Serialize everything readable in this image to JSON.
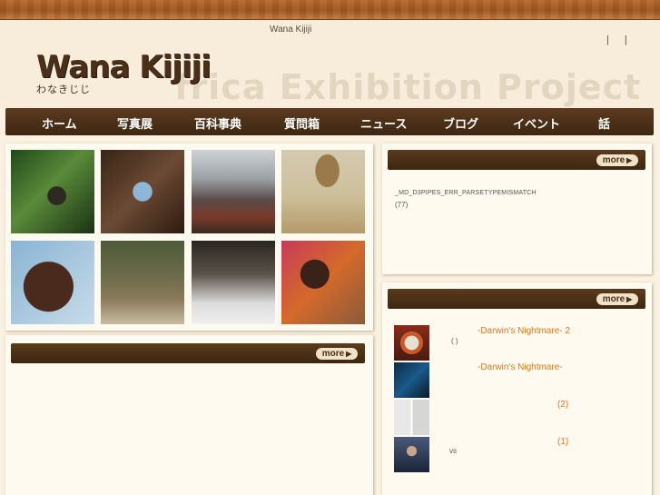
{
  "site": {
    "title": "Wana Kijiji",
    "top_links": [
      "|",
      "|"
    ],
    "watermark": "frica Exhibition Project",
    "logo_main": "Wana Kijiji",
    "logo_sub": "わなきじじ"
  },
  "nav": {
    "items": [
      "ホーム",
      "写真展",
      "百科事典",
      "質問箱",
      "ニュース",
      "ブログ",
      "イベント",
      "話"
    ]
  },
  "photos": {
    "items": [
      "jungle-insect",
      "blue-beetle",
      "crowd",
      "donkey-cart",
      "smiling-man",
      "ceremony",
      "rock-snow",
      "children-cooking"
    ]
  },
  "panels": {
    "more_label": "more",
    "right_top": {
      "error_text": "_MD_D3PIPES_ERR_PARSETYPEMISMATCH",
      "count": "(77)"
    },
    "right_bottom": {
      "entries": [
        {
          "title": "-Darwin's Nightmare-  2",
          "sub": "(  )"
        },
        {
          "title": "-Darwin's Nightmare-",
          "sub": ""
        },
        {
          "title": "(2)",
          "sub": ""
        },
        {
          "title": "(1)",
          "sub": "vs"
        }
      ]
    }
  },
  "colors": {
    "nav_bg": "#4a3018",
    "accent_orange": "#e07a1a",
    "page_bg": "#faf1e1"
  }
}
